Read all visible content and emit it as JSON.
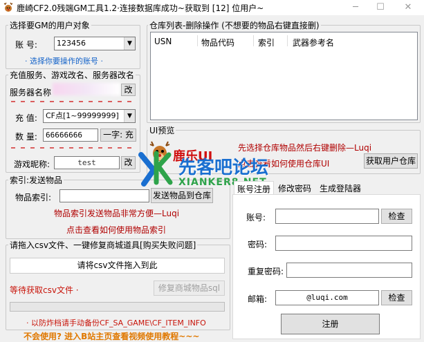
{
  "window": {
    "title": "鹿崎CF2.0残端GM工具1.2·连接数据库成功~获取到 [12] 位用户~",
    "minimize": "─",
    "maximize": "☐",
    "close": "✕"
  },
  "user_select": {
    "group_title": "选择要GM的用户对象",
    "account_label": "账    号:",
    "account_value": "123456",
    "hint": "· 选择你要操作的账号 ·"
  },
  "recharge": {
    "group_title": "充值服务、游戏改名、服务器改名",
    "server_label": "服务器名称",
    "server_btn": "改",
    "charge_label": "充  值:",
    "charge_value": "CF点[1~99999999]",
    "qty_label": "数  量:",
    "qty_value": "66666666",
    "charge_btn": "一字: 充",
    "nick_label": "游戏昵称:",
    "nick_value": "test",
    "nick_btn": "改"
  },
  "index_send": {
    "group_title": "索引:发送物品",
    "item_label": "物品索引:",
    "item_value": "",
    "send_btn": "发送物品到仓库",
    "tip1": "物品索引发送物品非常方便—Luqi",
    "tip2": "点击查看如何使用物品索引"
  },
  "csv": {
    "group_title": "请拖入csv文件、一键修复商城道具[购买失败问题]",
    "drop_area": "请将csv文件拖入到此",
    "status": "等待获取csv文件 ·",
    "fix_btn": "修复商城物品sql",
    "backup_hint": "· 以防炸档请手动备份CF_SA_GAME\\CF_ITEM_INFO",
    "bottom_link": "不会使用? 进入B站主页查看视频使用教程~~~"
  },
  "warehouse": {
    "group_title": "仓库列表-删除操作 (不想要的物品右键直接删)",
    "columns": [
      "USN",
      "物品代码",
      "索引",
      "武器参考名"
    ]
  },
  "ui_preview": {
    "group_title": "UI预览",
    "logo_text": "鹿乐UI",
    "tip1": "先选择仓库物品然后右键删除—Luqi",
    "tip2": "点击查看如何使用仓库UI",
    "get_btn": "获取用户仓库"
  },
  "watermark": {
    "main": "先客吧论坛",
    "sub": "XIANKER8.NET"
  },
  "tabs": {
    "items": [
      "账号注册",
      "修改密码",
      "生成登陆器"
    ],
    "active": 0
  },
  "register": {
    "account_label": "账号:",
    "account_value": "",
    "check_btn": "检查",
    "password_label": "密码:",
    "password_value": "",
    "repeat_label": "重复密码:",
    "repeat_value": "",
    "email_label": "邮箱:",
    "email_value": "@luqi.com",
    "email_check_btn": "检查",
    "submit_btn": "注册"
  },
  "colors": {
    "accent_blue": "#1060c8",
    "watermark_blue": "#1a6fd0",
    "watermark_green": "#2ea34a",
    "warning_red": "#c8140a",
    "orange": "#e07800"
  }
}
